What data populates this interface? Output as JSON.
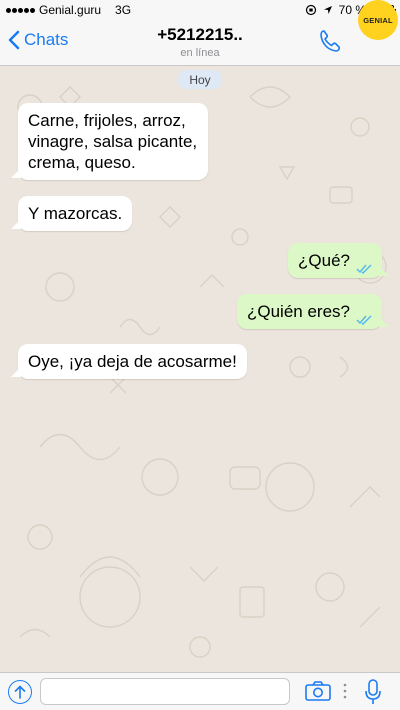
{
  "status_bar": {
    "carrier": "Genial.guru",
    "network": "3G",
    "battery": "70 %",
    "battery_level": 0.7
  },
  "header": {
    "back_label": "Chats",
    "contact_name": "+5212215..",
    "contact_status": "en línea",
    "logo_text": "GENIAL"
  },
  "chat": {
    "day_label": "Hoy",
    "messages": [
      {
        "direction": "in",
        "text": "Carne, frijoles, arroz, vinagre, salsa picante, crema, queso."
      },
      {
        "direction": "in",
        "text": "Y mazorcas."
      },
      {
        "direction": "out",
        "text": "¿Qué?",
        "read": true
      },
      {
        "direction": "out",
        "text": "¿Quién eres?",
        "read": true
      },
      {
        "direction": "in",
        "text": "Oye, ¡ya deja de acosarme!"
      }
    ]
  },
  "input_bar": {
    "placeholder": "",
    "icons": [
      "upload-arrow-icon",
      "camera-icon",
      "mic-icon"
    ]
  },
  "colors": {
    "accent": "#1a7cf4",
    "outgoing_bubble": "#dcf8c6",
    "incoming_bubble": "#ffffff",
    "chat_background": "#ece5dd",
    "read_ticks": "#4fb6ec",
    "logo": "#ffd21f"
  }
}
